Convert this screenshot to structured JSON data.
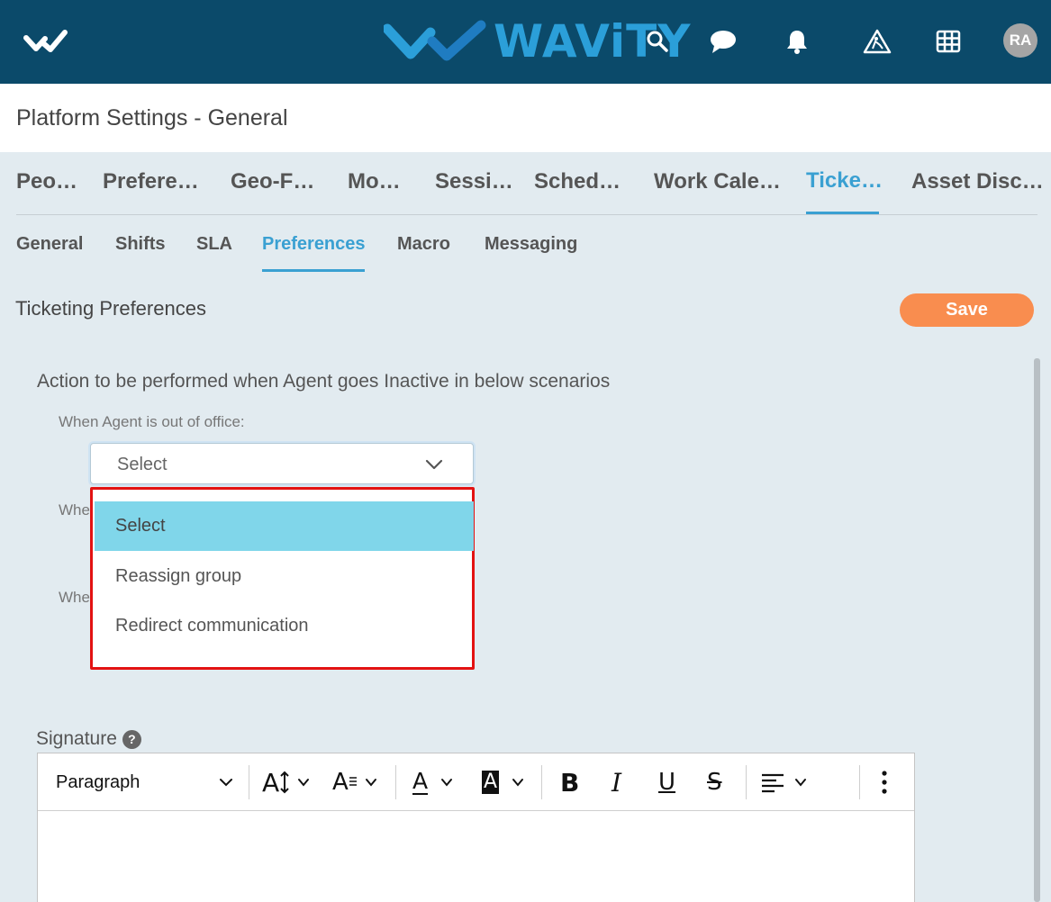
{
  "topbar": {
    "brand": "WAViTY",
    "avatar_initials": "RA",
    "icons": [
      "wavity-logo-icon",
      "search-icon",
      "chat-icon",
      "bell-icon",
      "construction-icon",
      "grid-icon"
    ],
    "background_color": "#0b4a6a",
    "brand_color": "#2b9fd9"
  },
  "page": {
    "title": "Platform Settings - General"
  },
  "primary_tabs": [
    "Peo…",
    "Prefere…",
    "Geo-F…",
    "Mo…",
    "Sessi…",
    "Sched…",
    "Work Cale…",
    "Ticke…",
    "Asset Disc…"
  ],
  "primary_active": "Ticke…",
  "secondary_tabs": [
    "General",
    "Shifts",
    "SLA",
    "Preferences",
    "Macro",
    "Messaging"
  ],
  "secondary_active": "Preferences",
  "section": {
    "title": "Ticketing Preferences",
    "save_label": "Save"
  },
  "form": {
    "heading": "Action to be performed when Agent goes Inactive in below scenarios",
    "field1_label": "When Agent is out of office:",
    "field2_label_partial": "Whe",
    "field3_label_partial": "Whe",
    "select_value": "Select",
    "dropdown_options": [
      "Select",
      "Reassign group",
      "Redirect communication"
    ],
    "dropdown_selected": "Select"
  },
  "signature": {
    "label": "Signature",
    "help_glyph": "?",
    "toolbar": {
      "paragraph_label": "Paragraph",
      "bold_glyph": "B",
      "italic_glyph": "I",
      "underline_glyph": "U",
      "strike_glyph": "S",
      "font_size_glyph": "A",
      "font_family_glyph": "A",
      "font_color_glyph": "A",
      "bg_color_glyph": "A"
    }
  },
  "colors": {
    "accent": "#3aa0d2",
    "save": "#f98d4f",
    "dropdown_highlight": "#80d6ea",
    "dropdown_border": "#e31212"
  }
}
